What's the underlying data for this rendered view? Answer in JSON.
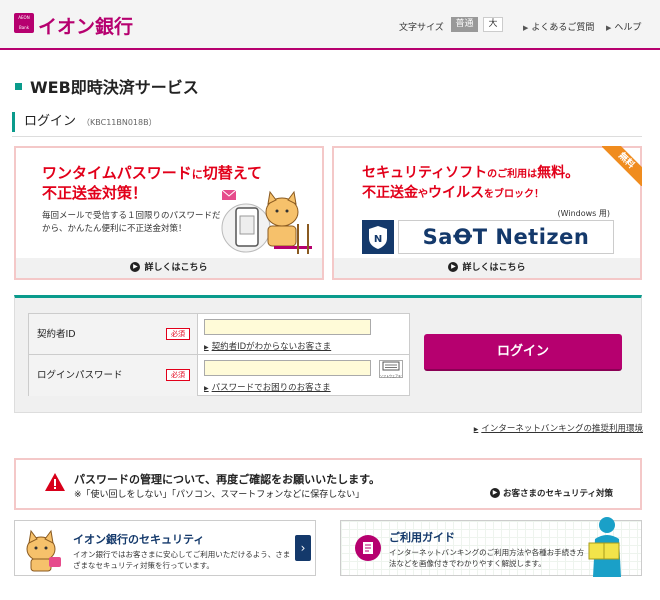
{
  "header": {
    "logo_small": "AEON Bank",
    "logo_text": "イオン銀行",
    "font_size_label": "文字サイズ",
    "font_size_standard": "普通",
    "font_size_large": "大",
    "faq_link": "よくあるご質問",
    "help_link": "ヘルプ",
    "accent_color": "#b6006f"
  },
  "page": {
    "section_title": "WEB即時決済サービス",
    "login_title": "ログイン",
    "login_code": "（KBC11BN018B）"
  },
  "promo_left": {
    "headline_1a": "ワンタイムパスワード",
    "headline_1b": "に",
    "headline_1c": "切替えて",
    "headline_2": "不正送金対策！",
    "desc": "毎回メールで受信する１回限りのパスワードだから、かんたん便利に不正送金対策！",
    "footer_link": "詳しくはこちら"
  },
  "promo_right": {
    "ribbon": "無料",
    "headline_1a": "セキュリティソフト",
    "headline_1b": "のご利用は",
    "headline_1c": "無料。",
    "headline_2a": "不正送金",
    "headline_2b": "や",
    "headline_2c": "ウイルス",
    "headline_2d": "をブロック！",
    "windows_note": "(Windows 用)",
    "logo_text": "SaꝊT Netizen",
    "footer_link": "詳しくはこちら"
  },
  "login_form": {
    "contract_id_label": "契約者ID",
    "required": "必須",
    "contract_id_value": "",
    "contract_id_help": "契約者IDがわからないお客さま",
    "password_label": "ログインパスワード",
    "password_value": "",
    "password_help": "パスワードでお困りのお客さま",
    "keyboard_label": "ソフトウェアキーボード",
    "login_button": "ログイン",
    "env_link": "インターネットバンキングの推奨利用環境"
  },
  "warning": {
    "line1": "パスワードの管理について、再度ご確認をお願いいたします。",
    "line2": "※「使い回しをしない」「パソコン、スマートフォンなどに保存しない」",
    "link": "お客さまのセキュリティ対策"
  },
  "cards": {
    "security_title": "イオン銀行のセキュリティ",
    "security_desc": "イオン銀行ではお客さまに安心してご利用いただけるよう、さまざまなセキュリティ対策を行っています。",
    "guide_title": "ご利用ガイド",
    "guide_desc": "インターネットバンキングのご利用方法や各種お手続き方法などを画像付きでわかりやすく解説します。"
  }
}
